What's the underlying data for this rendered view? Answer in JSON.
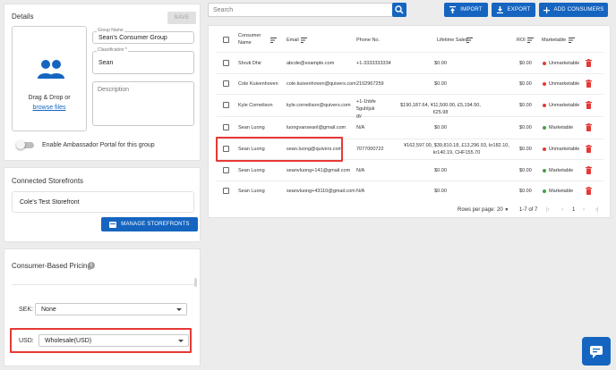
{
  "details": {
    "title": "Details",
    "save_label": "SAVE",
    "dropzone_line1": "Drag & Drop or",
    "dropzone_link": "browse files",
    "group_name_label": "Group Name",
    "group_name_value": "Sean's Consumer Group",
    "classification_label": "Classification *",
    "classification_value": "Sean",
    "description_placeholder": "Description",
    "ambassador_label": "Enable Ambassador Portal for this group"
  },
  "storefronts": {
    "title": "Connected Storefronts",
    "items": [
      "Cole's Test Storefront"
    ],
    "manage_label": "MANAGE STOREFRONTS"
  },
  "pricing": {
    "title": "Consumer-Based Pricing",
    "info": "i",
    "rows": [
      {
        "currency": "SEK:",
        "value": "None"
      },
      {
        "currency": "USD:",
        "value": "Wholesale(USD)"
      }
    ]
  },
  "toolbar": {
    "search_placeholder": "Search",
    "import_label": "IMPORT",
    "export_label": "EXPORT",
    "add_label": "ADD CONSUMERS"
  },
  "table": {
    "headers": {
      "name": "Consumer Name",
      "email": "Email",
      "phone": "Phone No.",
      "sales": "Lifetime Sales",
      "roi": "ROI",
      "marketable": "Marketable"
    },
    "rows": [
      {
        "name": "Shruti Dhir",
        "email": "abcde@example.com",
        "phone": "+1-3333333334",
        "sales": "$0.00",
        "roi": "$0.00",
        "status": "Unmarketable"
      },
      {
        "name": "Cole Kuivenhoven",
        "email": "cole.kuivenhoven@quivers.com",
        "phone": "2102967259",
        "sales": "$0.00",
        "roi": "$0.00",
        "status": "Unmarketable"
      },
      {
        "name": "Kyle Cornelison",
        "email": "kyle.cornelison@quivers.com",
        "phone": "+1-1hbfe5guhljukgy",
        "sales": "$190,187.64, ¥11,500.00, £5,194.50, €25.98",
        "roi": "$0.00",
        "status": "Unmarketable"
      },
      {
        "name": "Sean Luong",
        "email": "luongvanseanl@gmail.com",
        "phone": "N/A",
        "sales": "$0.00",
        "roi": "$0.00",
        "status": "Marketable"
      },
      {
        "name": "Sean Luong",
        "email": "sean.luong@quivers.com",
        "phone": "7077000722",
        "sales": "¥162,597.00, $39,810.18, £13,296.93, kr182.10, kr140.19, CHF155.70",
        "roi": "$0.00",
        "status": "Unmarketable"
      },
      {
        "name": "Sean Luong",
        "email": "seanvluong+141@gmail.com",
        "phone": "N/A",
        "sales": "$0.00",
        "roi": "$0.00",
        "status": "Marketable"
      },
      {
        "name": "Sean Luong",
        "email": "seanvluong+43110@gmail.com",
        "phone": "N/A",
        "sales": "$0.00",
        "roi": "$0.00",
        "status": "Marketable"
      }
    ],
    "rows_per_page_label": "Rows per page:",
    "rows_per_page": "20",
    "range": "1-7 of 7",
    "page": "1"
  },
  "colors": {
    "primary": "#1565c0",
    "marketable": "#43a047",
    "unmarketable": "#e53935",
    "trash": "#e53935",
    "highlight": "#e53935"
  }
}
